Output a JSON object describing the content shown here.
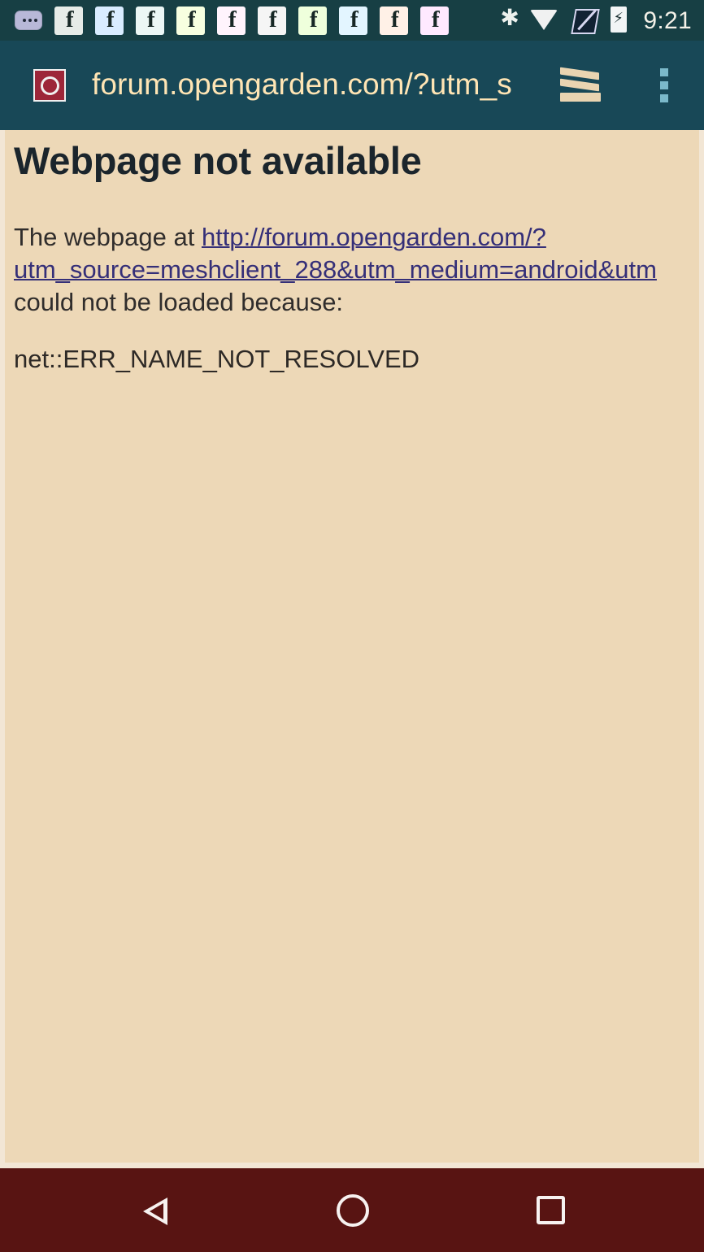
{
  "status_bar": {
    "notification_icons": [
      "message-icon",
      "facebook-icon",
      "facebook-icon",
      "facebook-icon",
      "facebook-icon",
      "facebook-icon",
      "facebook-icon",
      "facebook-icon",
      "facebook-icon",
      "facebook-icon",
      "facebook-icon"
    ],
    "system_icons": [
      "bluetooth-icon",
      "wifi-icon",
      "signal-icon",
      "battery-charging-icon"
    ],
    "time": "9:21"
  },
  "browser": {
    "url": "forum.opengarden.com/?utm_s",
    "site_icon": "globe-icon",
    "tabs_icon": "tabs-icon",
    "menu_icon": "more-vertical-icon"
  },
  "error_page": {
    "title": "Webpage not available",
    "message_prefix": "The webpage at ",
    "link_line_1": "http://forum.opengarden.com/?",
    "link_line_2": "utm_source=meshclient_288&utm_medium=android&utm",
    "message_suffix": "could not be loaded because:",
    "error_code": "net::ERR_NAME_NOT_RESOLVED"
  },
  "navigation_bar": {
    "back_icon": "back-icon",
    "home_icon": "home-icon",
    "recents_icon": "recents-icon"
  },
  "colors": {
    "status_bar": "#173f44",
    "browser_bar": "#184857",
    "url_text": "#ffe5b4",
    "page_background": "#edd8b7",
    "link": "#352f78",
    "navigation_bar": "#581412"
  }
}
